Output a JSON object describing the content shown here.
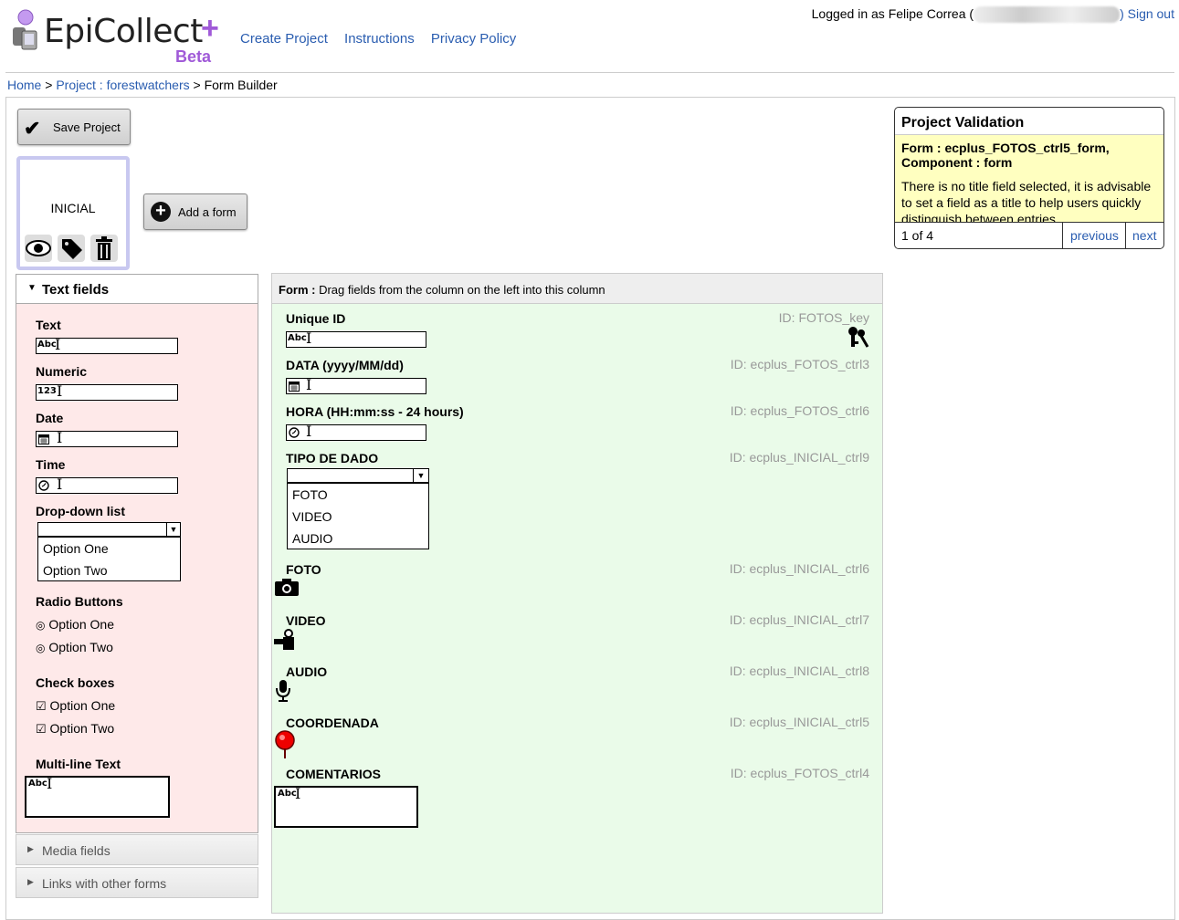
{
  "header": {
    "logo_text": "EpiCollect",
    "logo_plus": "+",
    "logo_beta": "Beta",
    "nav": [
      "Create Project",
      "Instructions",
      "Privacy Policy"
    ],
    "logged_in": "Logged in as Felipe Correa (",
    "sign_out": ") Sign out"
  },
  "breadcrumb": {
    "home": "Home",
    "sep1": " > ",
    "project": "Project : forestwatchers",
    "sep2": " > ",
    "current": "Form Builder"
  },
  "toolbar": {
    "save_label": "Save Project",
    "add_form_label": "Add a form"
  },
  "form_card": {
    "name": "INICIAL"
  },
  "validation": {
    "title": "Project Validation",
    "form_line": "Form : ecplus_FOTOS_ctrl5_form, Component : form",
    "message": "There is no title field selected, it is advisable to set a field as a title to help users quickly distinguish between entries",
    "count": "1 of 4",
    "previous": "previous",
    "next": "next"
  },
  "palette": {
    "section_title": "Text fields",
    "text_label": "Text",
    "text_icon": "Abc",
    "numeric_label": "Numeric",
    "numeric_icon": "123",
    "date_label": "Date",
    "time_label": "Time",
    "dropdown_label": "Drop-down list",
    "dropdown_options": [
      "Option One",
      "Option Two"
    ],
    "radio_label": "Radio Buttons",
    "radio_options": [
      "Option One",
      "Option Two"
    ],
    "checkbox_label": "Check boxes",
    "checkbox_options": [
      "Option One",
      "Option Two"
    ],
    "multiline_label": "Multi-line Text",
    "multiline_icon": "Abc",
    "media_section": "Media fields",
    "links_section": "Links with other forms"
  },
  "form": {
    "head_bold": "Form :",
    "head_text": " Drag fields from the column on the left into this column",
    "fields": [
      {
        "label": "Unique ID",
        "id": "ID: FOTOS_key",
        "icon": "Abc"
      },
      {
        "label": "DATA (yyyy/MM/dd)",
        "id": "ID: ecplus_FOTOS_ctrl3"
      },
      {
        "label": "HORA (HH:mm:ss - 24 hours)",
        "id": "ID: ecplus_FOTOS_ctrl6"
      },
      {
        "label": "TIPO DE DADO",
        "id": "ID: ecplus_INICIAL_ctrl9",
        "options": [
          "FOTO",
          "VIDEO",
          "AUDIO"
        ]
      },
      {
        "label": "FOTO",
        "id": "ID: ecplus_INICIAL_ctrl6"
      },
      {
        "label": "VIDEO",
        "id": "ID: ecplus_INICIAL_ctrl7"
      },
      {
        "label": "AUDIO",
        "id": "ID: ecplus_INICIAL_ctrl8"
      },
      {
        "label": "COORDENADA",
        "id": "ID: ecplus_INICIAL_ctrl5"
      },
      {
        "label": "COMENTARIOS",
        "id": "ID: ecplus_FOTOS_ctrl4",
        "icon": "Abc"
      }
    ]
  },
  "colors": {
    "link": "#2a5db0",
    "brand_purple": "#a05ad8",
    "palette_bg": "#fee9e9",
    "form_bg": "#eafbe9",
    "validation_bg": "#ffffc0"
  }
}
